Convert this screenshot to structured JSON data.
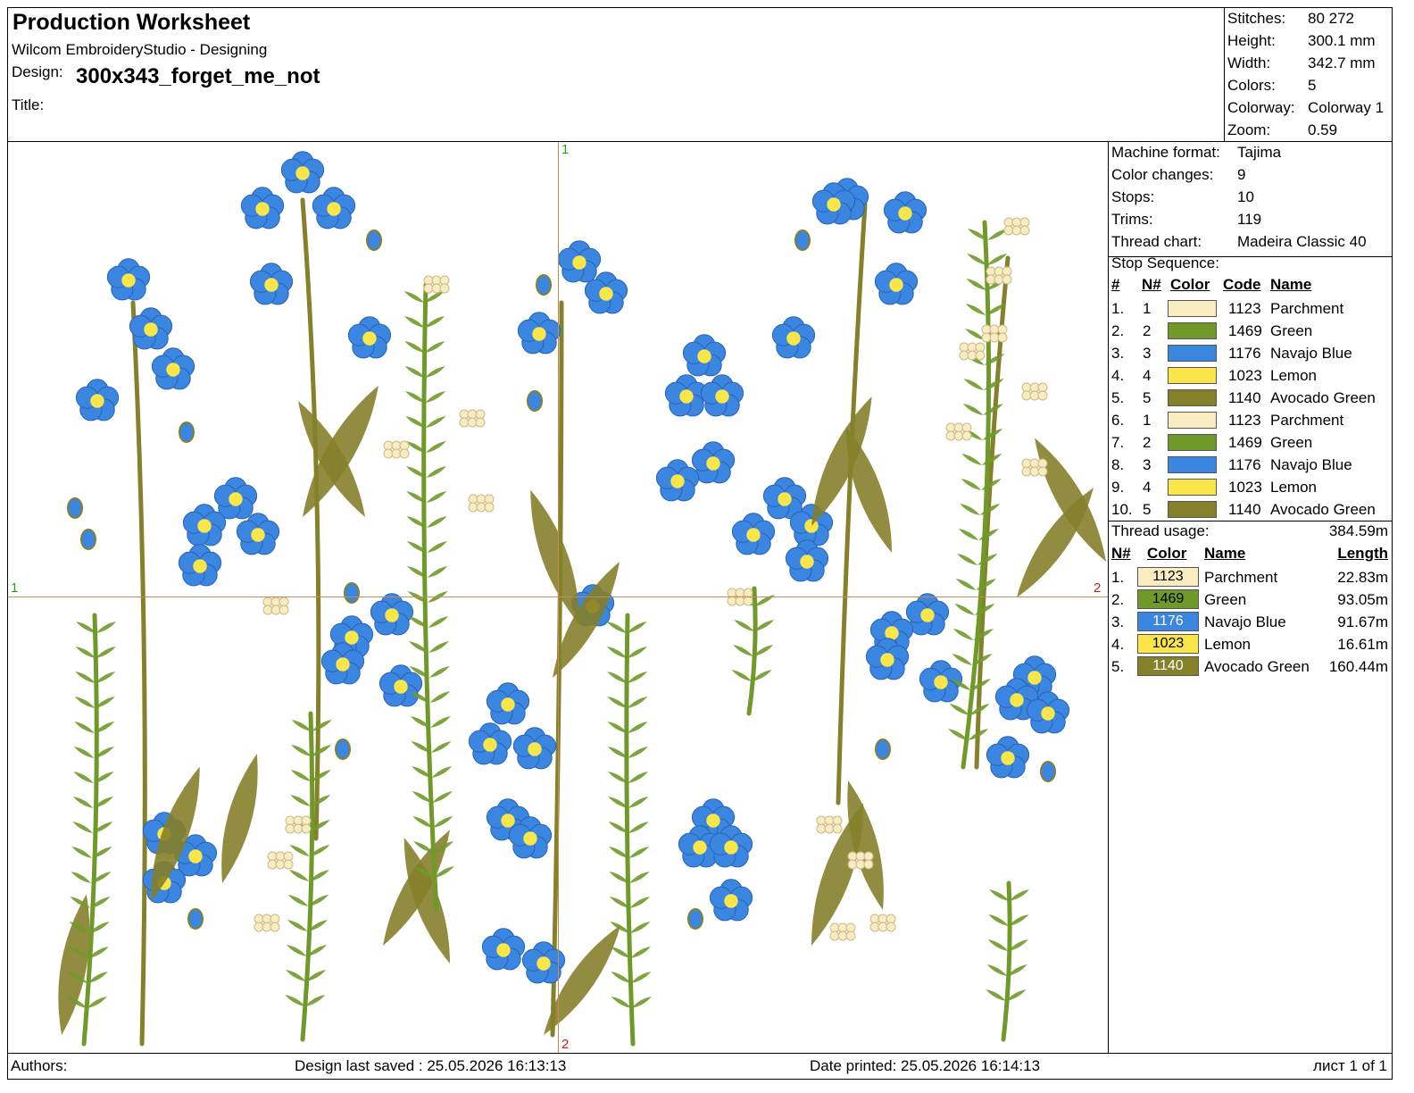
{
  "header": {
    "title": "Production Worksheet",
    "software": "Wilcom EmbroideryStudio - Designing",
    "design_label": "Design:",
    "design_name": "300x343_forget_me_not",
    "title_label": "Title:"
  },
  "stats": [
    {
      "label": "Stitches:",
      "value": "80 272"
    },
    {
      "label": "Height:",
      "value": "300.1 mm"
    },
    {
      "label": "Width:",
      "value": "342.7 mm"
    },
    {
      "label": "Colors:",
      "value": "5"
    },
    {
      "label": "Colorway:",
      "value": "Colorway 1"
    },
    {
      "label": "Zoom:",
      "value": "0.59"
    }
  ],
  "machine": [
    {
      "label": "Machine format:",
      "value": "Tajima"
    },
    {
      "label": "Color changes:",
      "value": "9"
    },
    {
      "label": "Stops:",
      "value": "10"
    },
    {
      "label": "Trims:",
      "value": "119"
    },
    {
      "label": "Thread chart:",
      "value": "Madeira Classic 40"
    }
  ],
  "stop_sequence": {
    "title": "Stop Sequence:",
    "headers": {
      "num": "#",
      "n": "N#",
      "color": "Color",
      "code": "Code",
      "name": "Name"
    },
    "rows": [
      {
        "num": "1.",
        "n": "1",
        "code": "1123",
        "name": "Parchment",
        "color": "#f9ecc0"
      },
      {
        "num": "2.",
        "n": "2",
        "code": "1469",
        "name": "Green",
        "color": "#6f9a2a"
      },
      {
        "num": "3.",
        "n": "3",
        "code": "1176",
        "name": "Navajo Blue",
        "color": "#3a86e0"
      },
      {
        "num": "4.",
        "n": "4",
        "code": "1023",
        "name": "Lemon",
        "color": "#fbe64a"
      },
      {
        "num": "5.",
        "n": "5",
        "code": "1140",
        "name": "Avocado Green",
        "color": "#85802a"
      },
      {
        "num": "6.",
        "n": "1",
        "code": "1123",
        "name": "Parchment",
        "color": "#f9ecc0"
      },
      {
        "num": "7.",
        "n": "2",
        "code": "1469",
        "name": "Green",
        "color": "#6f9a2a"
      },
      {
        "num": "8.",
        "n": "3",
        "code": "1176",
        "name": "Navajo Blue",
        "color": "#3a86e0"
      },
      {
        "num": "9.",
        "n": "4",
        "code": "1023",
        "name": "Lemon",
        "color": "#fbe64a"
      },
      {
        "num": "10.",
        "n": "5",
        "code": "1140",
        "name": "Avocado Green",
        "color": "#85802a"
      }
    ]
  },
  "thread_usage": {
    "label": "Thread usage:",
    "total": "384.59m",
    "headers": {
      "n": "N#",
      "color": "Color",
      "name": "Name",
      "length": "Length"
    },
    "rows": [
      {
        "n": "1.",
        "code": "1123",
        "name": "Parchment",
        "length": "22.83m",
        "color": "#f9ecc0",
        "text": "#000"
      },
      {
        "n": "2.",
        "code": "1469",
        "name": "Green",
        "length": "93.05m",
        "color": "#6f9a2a",
        "text": "#000"
      },
      {
        "n": "3.",
        "code": "1176",
        "name": "Navajo Blue",
        "length": "91.67m",
        "color": "#3a86e0",
        "text": "#fff"
      },
      {
        "n": "4.",
        "code": "1023",
        "name": "Lemon",
        "length": "16.61m",
        "color": "#fbe64a",
        "text": "#000"
      },
      {
        "n": "5.",
        "code": "1140",
        "name": "Avocado Green",
        "length": "160.44m",
        "color": "#85802a",
        "text": "#fff"
      }
    ]
  },
  "canvas": {
    "markers": {
      "top": "1",
      "left": "1",
      "right": "2",
      "bottom": "2"
    },
    "top_marker_color": "#1fa31f",
    "bottom_marker_color": "#d21a1a",
    "guide_color": "#c88a55"
  },
  "footer": {
    "authors": "Authors:",
    "saved": "Design last saved : 25.05.2026 16:13:13",
    "printed": "Date printed: 25.05.2026 16:14:13",
    "page": "лист 1 of 1"
  }
}
